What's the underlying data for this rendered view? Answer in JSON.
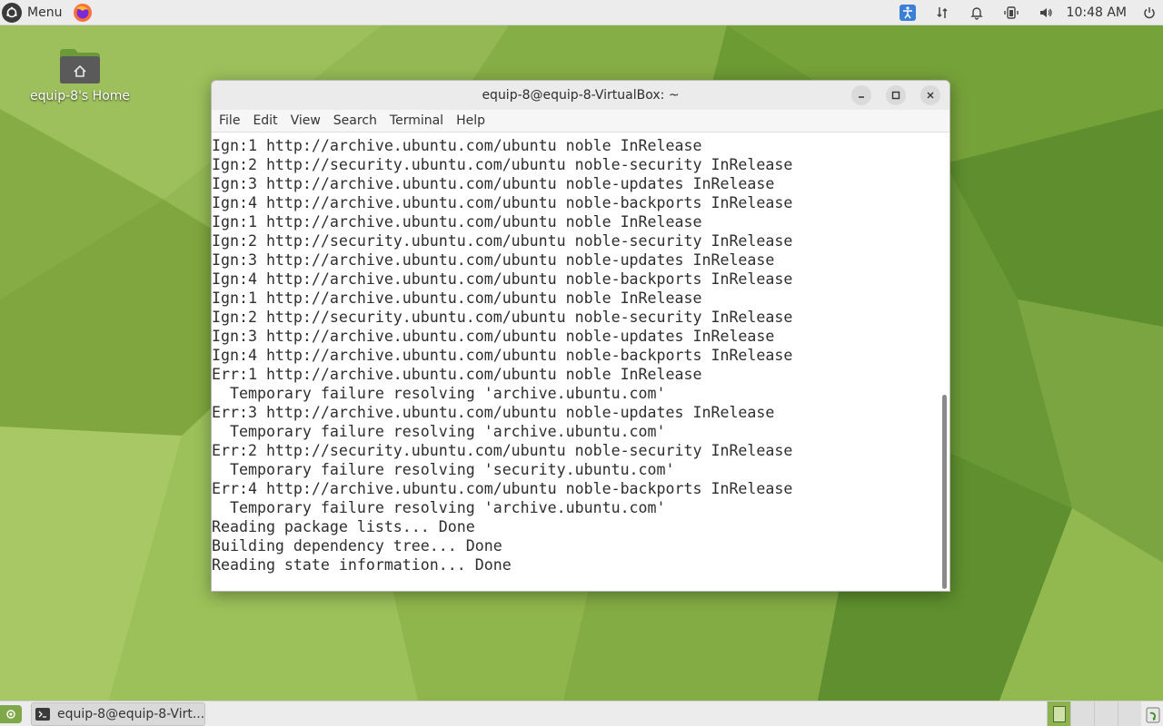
{
  "top_panel": {
    "menu_label": "Menu",
    "clock": "10:48 AM",
    "icons": [
      "ubuntu-logo-icon",
      "firefox-icon",
      "accessibility-icon",
      "network-icon",
      "notification-bell-icon",
      "battery-icon",
      "volume-icon",
      "power-icon"
    ]
  },
  "desktop": {
    "home_icon_label": "equip-8's Home"
  },
  "window": {
    "title": "equip-8@equip-8-VirtualBox: ~",
    "menu": [
      "File",
      "Edit",
      "View",
      "Search",
      "Terminal",
      "Help"
    ],
    "terminal_lines": [
      "Ign:1 http://archive.ubuntu.com/ubuntu noble InRelease",
      "Ign:2 http://security.ubuntu.com/ubuntu noble-security InRelease",
      "Ign:3 http://archive.ubuntu.com/ubuntu noble-updates InRelease",
      "Ign:4 http://archive.ubuntu.com/ubuntu noble-backports InRelease",
      "Ign:1 http://archive.ubuntu.com/ubuntu noble InRelease",
      "Ign:2 http://security.ubuntu.com/ubuntu noble-security InRelease",
      "Ign:3 http://archive.ubuntu.com/ubuntu noble-updates InRelease",
      "Ign:4 http://archive.ubuntu.com/ubuntu noble-backports InRelease",
      "Ign:1 http://archive.ubuntu.com/ubuntu noble InRelease",
      "Ign:2 http://security.ubuntu.com/ubuntu noble-security InRelease",
      "Ign:3 http://archive.ubuntu.com/ubuntu noble-updates InRelease",
      "Ign:4 http://archive.ubuntu.com/ubuntu noble-backports InRelease",
      "Err:1 http://archive.ubuntu.com/ubuntu noble InRelease",
      "  Temporary failure resolving 'archive.ubuntu.com'",
      "Err:3 http://archive.ubuntu.com/ubuntu noble-updates InRelease",
      "  Temporary failure resolving 'archive.ubuntu.com'",
      "Err:2 http://security.ubuntu.com/ubuntu noble-security InRelease",
      "  Temporary failure resolving 'security.ubuntu.com'",
      "Err:4 http://archive.ubuntu.com/ubuntu noble-backports InRelease",
      "  Temporary failure resolving 'archive.ubuntu.com'",
      "Reading package lists... Done",
      "Building dependency tree... Done",
      "Reading state information... Done"
    ]
  },
  "bottom_panel": {
    "task_label": "equip-8@equip-8-Virt..."
  },
  "colors": {
    "wallpaper_base": "#8db34a",
    "panel": "#ececec",
    "accent": "#3b7fd6",
    "workspace_active": "#8bb34f"
  }
}
